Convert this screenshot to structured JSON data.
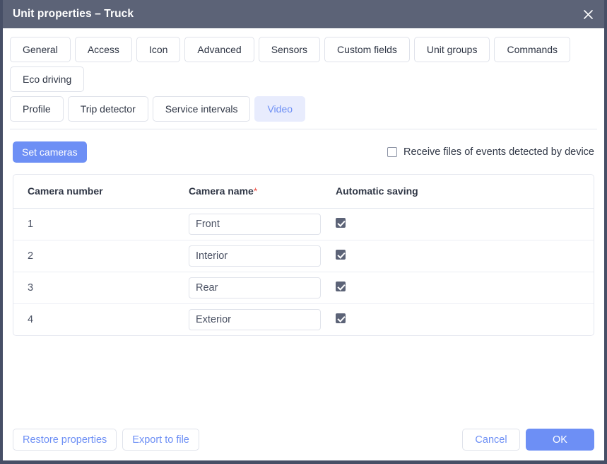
{
  "window": {
    "title": "Unit properties – Truck",
    "close_icon": "close-icon",
    "titlebar_color": "#5c6377",
    "accent_color": "#6d8ff5"
  },
  "tabs": {
    "row1": [
      {
        "label": "General",
        "active": false
      },
      {
        "label": "Access",
        "active": false
      },
      {
        "label": "Icon",
        "active": false
      },
      {
        "label": "Advanced",
        "active": false
      },
      {
        "label": "Sensors",
        "active": false
      },
      {
        "label": "Custom fields",
        "active": false
      },
      {
        "label": "Unit groups",
        "active": false
      },
      {
        "label": "Commands",
        "active": false
      },
      {
        "label": "Eco driving",
        "active": false
      }
    ],
    "row2": [
      {
        "label": "Profile",
        "active": false
      },
      {
        "label": "Trip detector",
        "active": false
      },
      {
        "label": "Service intervals",
        "active": false
      },
      {
        "label": "Video",
        "active": true
      }
    ]
  },
  "toolbar": {
    "set_cameras_label": "Set cameras",
    "receive_files_label": "Receive files of events detected by device",
    "receive_files_checked": false
  },
  "table": {
    "headers": {
      "number": "Camera number",
      "name": "Camera name",
      "name_required_mark": "*",
      "auto_saving": "Automatic saving"
    },
    "rows": [
      {
        "number": "1",
        "name": "Front",
        "name_placeholder": "",
        "auto_saving": true
      },
      {
        "number": "2",
        "name": "Interior",
        "name_placeholder": "",
        "auto_saving": true
      },
      {
        "number": "3",
        "name": "Rear",
        "name_placeholder": "",
        "auto_saving": true
      },
      {
        "number": "4",
        "name": "Exterior",
        "name_placeholder": "",
        "auto_saving": true
      }
    ]
  },
  "footer": {
    "restore_label": "Restore properties",
    "export_label": "Export to file",
    "cancel_label": "Cancel",
    "ok_label": "OK"
  }
}
